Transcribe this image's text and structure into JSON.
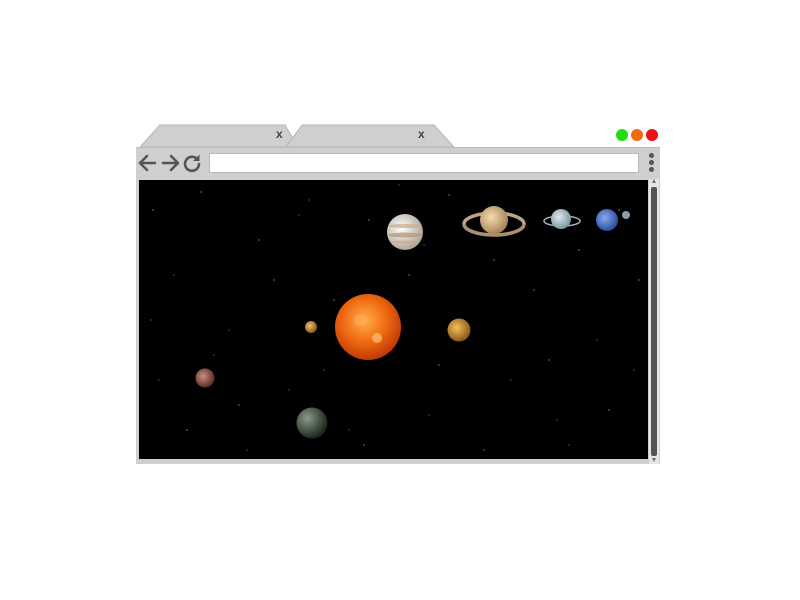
{
  "tabs": [
    {
      "label": "",
      "close_glyph": "x"
    },
    {
      "label": "",
      "close_glyph": "x"
    }
  ],
  "window_controls": {
    "colors": [
      "#22dd11",
      "#f26a10",
      "#ee1111"
    ]
  },
  "toolbar": {
    "back_icon": "arrow-left-icon",
    "forward_icon": "arrow-right-icon",
    "reload_icon": "reload-icon",
    "address_value": "",
    "address_placeholder": "",
    "menu_icon": "kebab-menu-icon"
  },
  "content": {
    "scene": "solar-system",
    "background_color": "#000000",
    "bodies": [
      "sun",
      "mercury",
      "venus",
      "earth",
      "mars",
      "jupiter",
      "saturn",
      "uranus",
      "neptune",
      "moon"
    ]
  },
  "scrollbar": {
    "up_glyph": "▲",
    "down_glyph": "▼"
  }
}
